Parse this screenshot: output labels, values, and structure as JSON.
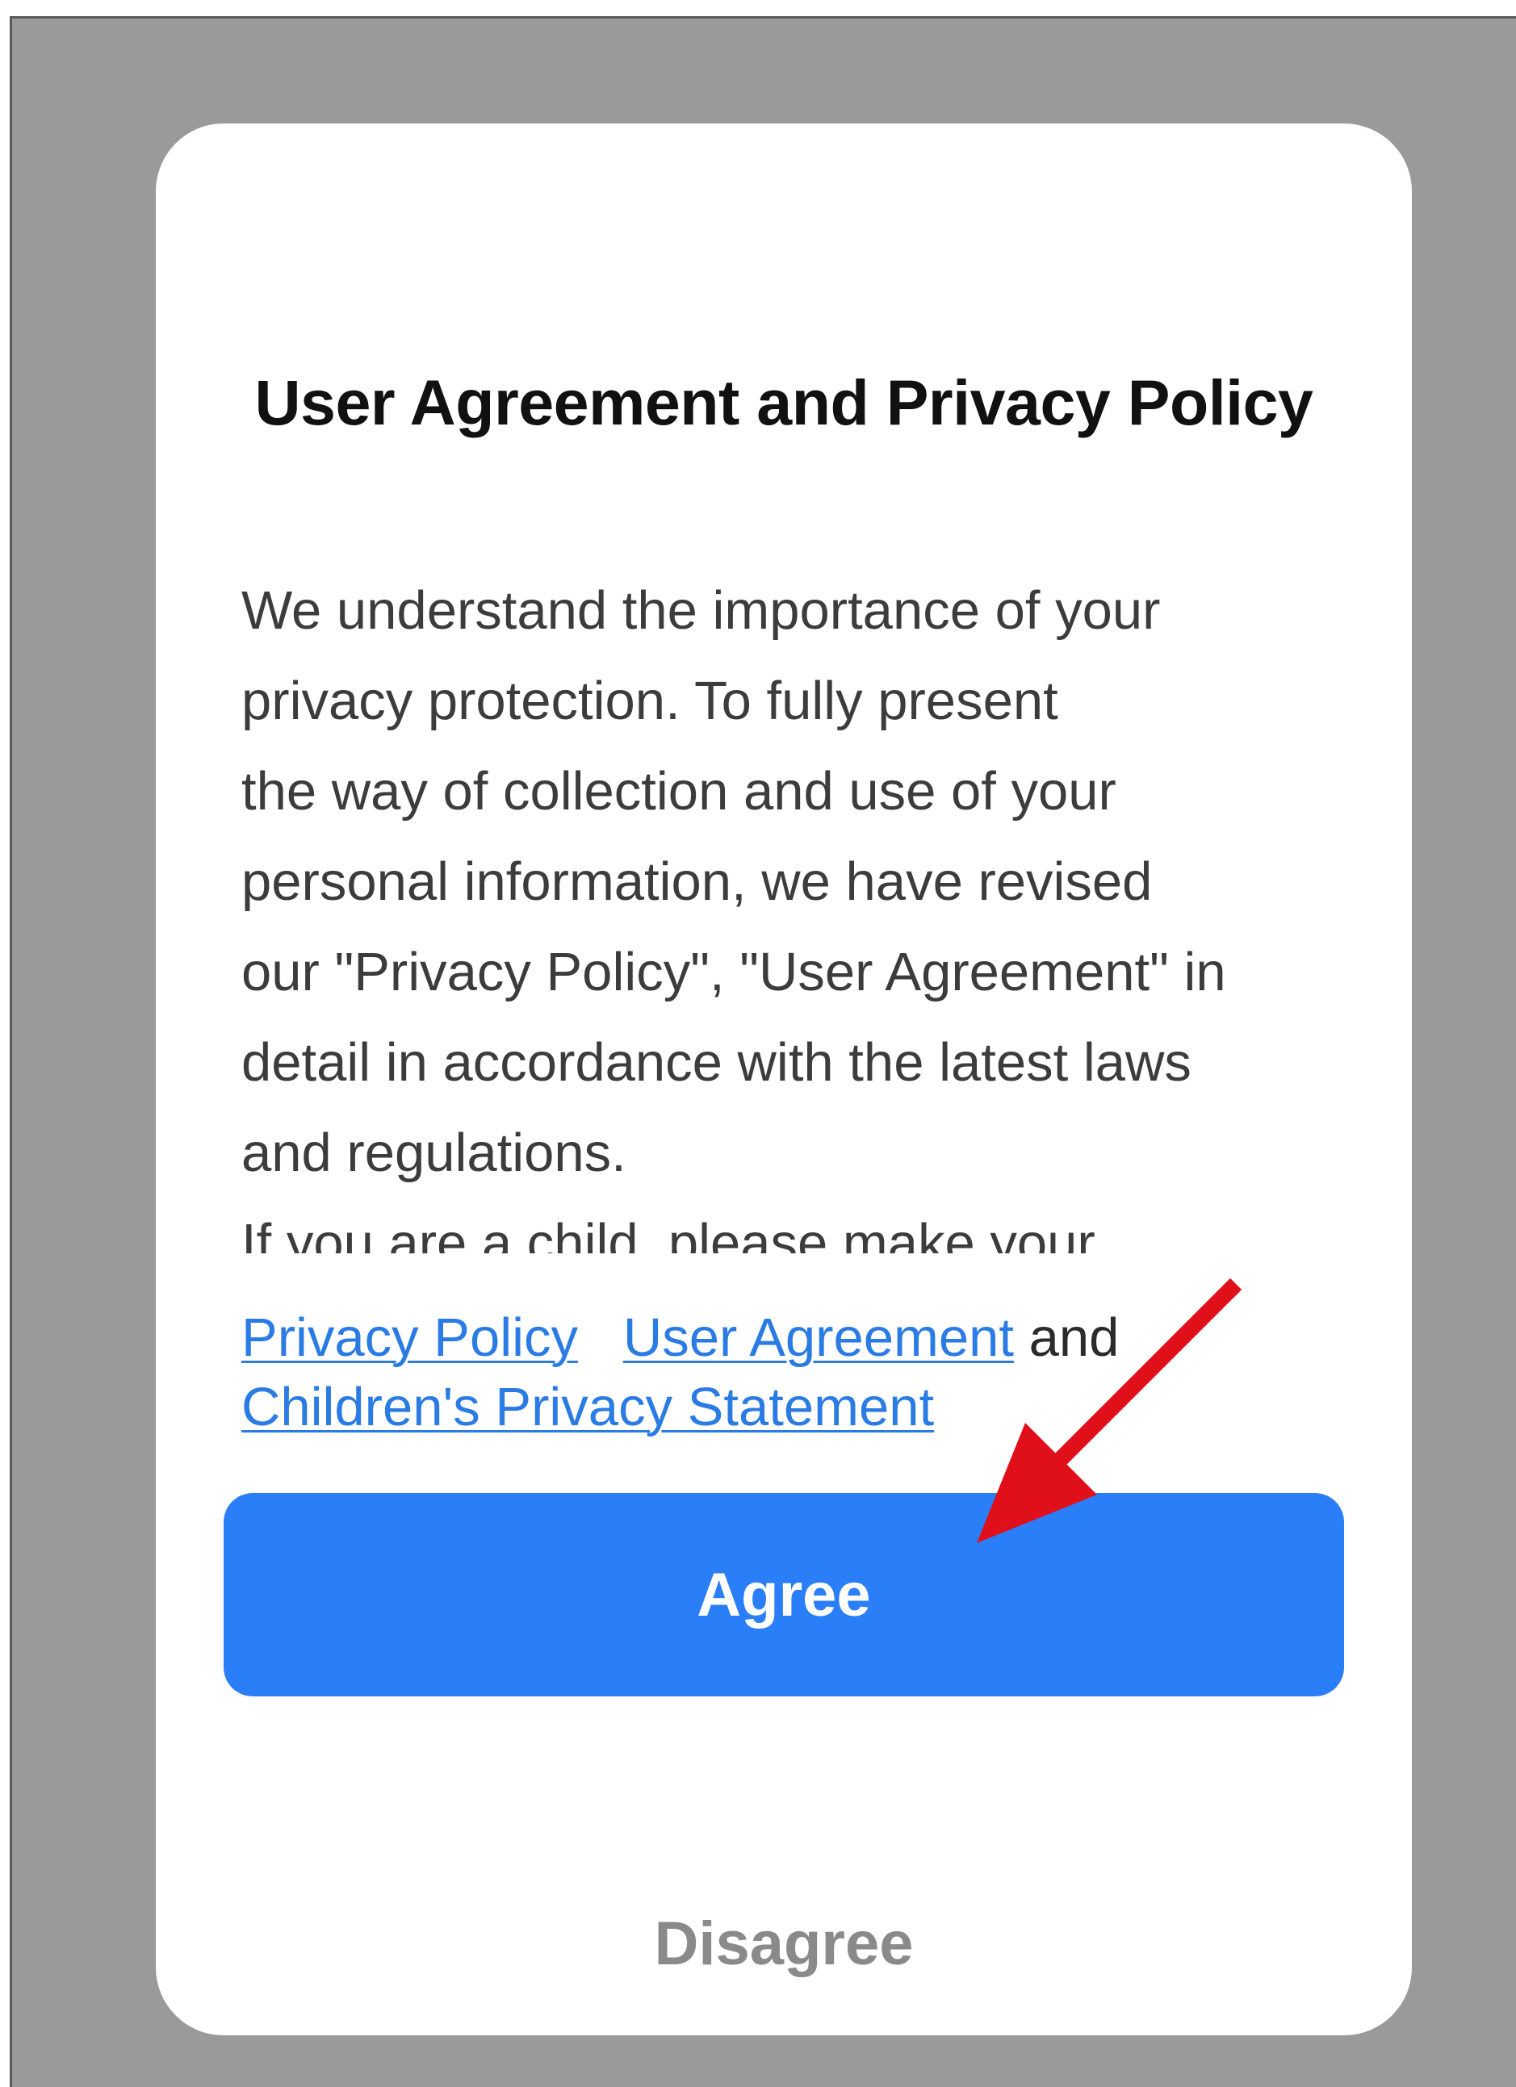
{
  "dialog": {
    "title": "User Agreement and Privacy Policy",
    "body_lines": [
      "We understand the importance of your",
      "privacy protection. To fully present",
      "the way of collection and use of your",
      "personal information, we have revised",
      "our \"Privacy Policy\", \"User Agreement\" in",
      "detail in accordance with the latest laws",
      "and regulations.",
      "If you are a child, please make your"
    ],
    "links": {
      "privacy_policy": "Privacy Policy",
      "user_agreement": "User Agreement",
      "and_text": "and",
      "childrens_privacy": "Children's Privacy Statement"
    },
    "agree_label": "Agree",
    "disagree_label": "Disagree"
  },
  "colors": {
    "overlay": "#9a9a9a",
    "primary_button": "#2a7ef8",
    "link": "#2a7be4",
    "annotation_arrow": "#e0101a"
  }
}
